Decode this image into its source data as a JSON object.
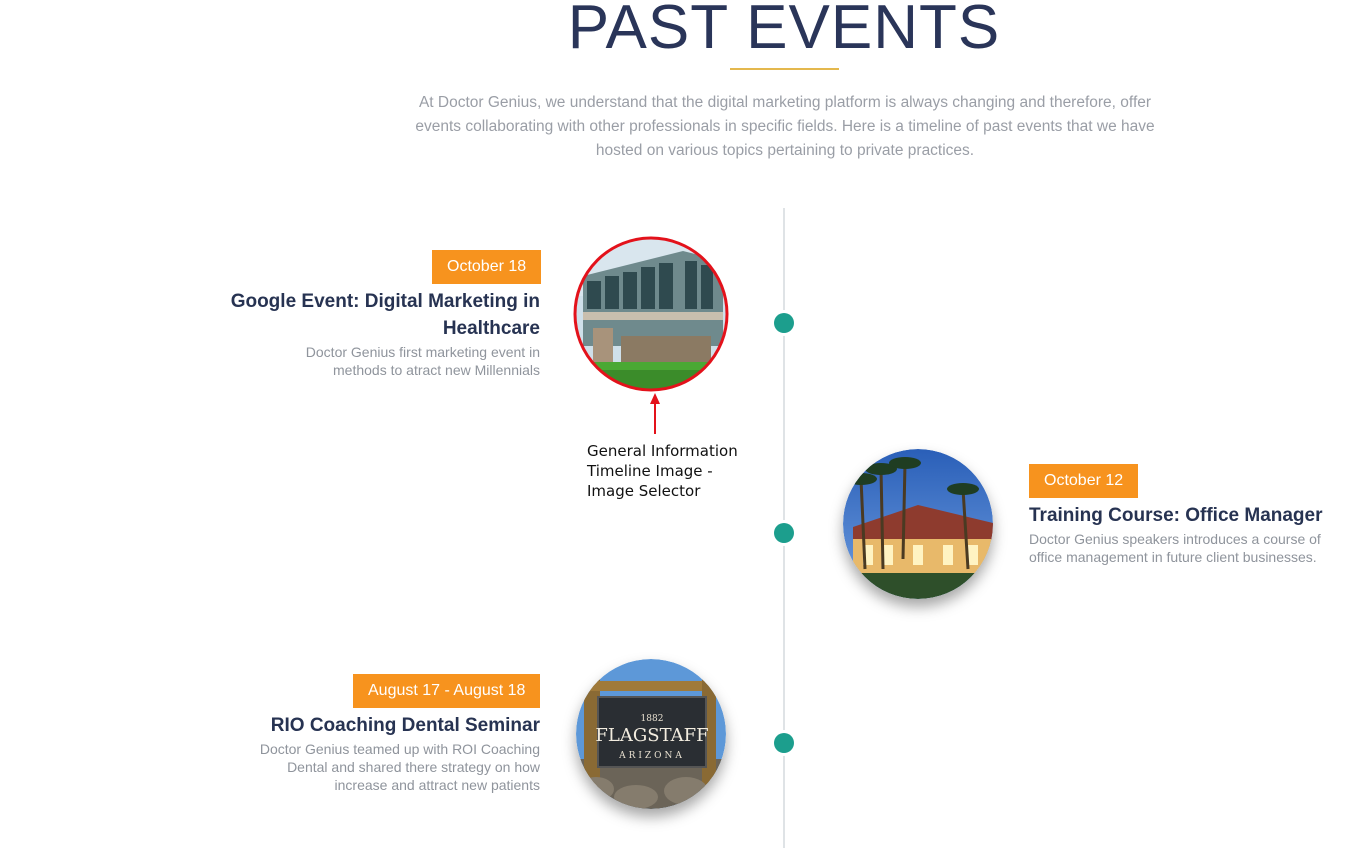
{
  "header": {
    "title": "PAST EVENTS",
    "intro": "At Doctor Genius, we understand that the digital marketing platform is always changing and therefore, offer events collaborating with other professionals in specific fields. Here is a timeline of past events that we have hosted on various topics pertaining to private practices."
  },
  "events": [
    {
      "date": "October 18",
      "title": "Google Event: Digital Marketing in Healthcare",
      "description": "Doctor Genius first marketing event in methods to atract new Millennials",
      "image_icon": "office-building-photo"
    },
    {
      "date": "October 12",
      "title": "Training Course: Office Manager",
      "description": "Doctor Genius speakers introduces a course of office management in future client businesses.",
      "image_icon": "resort-palm-trees-photo"
    },
    {
      "date": "August 17 - August 18",
      "title": "RIO Coaching Dental Seminar",
      "description": "Doctor Genius teamed up with ROI Coaching Dental and shared there strategy on how increase and attract new patients",
      "image_icon": "flagstaff-sign-photo",
      "sign_year": "1882",
      "sign_name": "FLAGSTAFF",
      "sign_state": "ARIZONA"
    }
  ],
  "annotation": {
    "text": "General Information Timeline Image - Image Selector",
    "highlight_color": "#e3121b"
  },
  "colors": {
    "badge": "#f7931e",
    "dot": "#1c9e8d",
    "title": "#273352",
    "rule": "#e4b84d"
  }
}
